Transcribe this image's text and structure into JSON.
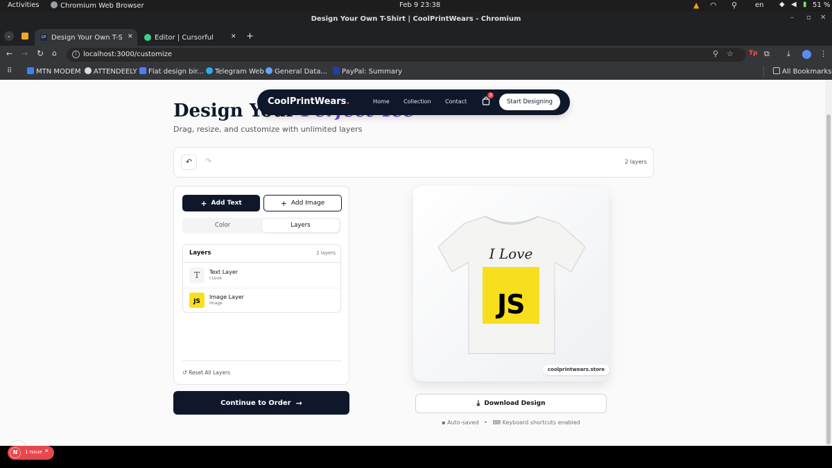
{
  "os": {
    "activities": "Activities",
    "app_name": "Chromium Web Browser",
    "datetime": "Feb 9  23:38",
    "language": "en",
    "battery": "51 %"
  },
  "window": {
    "title": "Design Your Own T-Shirt | CoolPrintWears - Chromium"
  },
  "tabs": [
    {
      "label": "Design Your Own T-Shirt",
      "active": true
    },
    {
      "label": "Editor | Cursorful",
      "active": false
    }
  ],
  "address": {
    "url": "localhost:3000/customize"
  },
  "bookmarks": {
    "items": [
      {
        "label": "MTN MODEM"
      },
      {
        "label": "ATTENDEELY"
      },
      {
        "label": "Flat design bir..."
      },
      {
        "label": "Telegram Web"
      },
      {
        "label": "General Data..."
      },
      {
        "label": "PayPal: Summary"
      }
    ],
    "all_label": "All Bookmarks"
  },
  "nav": {
    "logo": "CoolPrintWears",
    "logo_dot": ".",
    "links": [
      {
        "label": "Home"
      },
      {
        "label": "Collection"
      },
      {
        "label": "Contact"
      }
    ],
    "cart_count": "3",
    "cta": "Start Designing"
  },
  "hero": {
    "title_main": "Design Your",
    "title_accent": "Perfect Tee",
    "subtitle": "Drag, resize, and customize with unlimited layers"
  },
  "toolbar": {
    "layers_count": "2 layers"
  },
  "panel": {
    "add_text": "Add Text",
    "add_image": "Add Image",
    "tabs": [
      {
        "label": "Color",
        "active": false
      },
      {
        "label": "Layers",
        "active": true
      }
    ],
    "layers_title": "Layers",
    "layers_count": "2 layers",
    "layers": [
      {
        "name": "Text Layer",
        "sub": "I Love",
        "icon": "T"
      },
      {
        "name": "Image Layer",
        "sub": "Image",
        "icon": "JS"
      }
    ],
    "reset_label": "Reset All Layers"
  },
  "continue_label": "Continue to Order",
  "preview": {
    "shirt_text": "I Love",
    "logo_text": "JS",
    "watermark": "coolprintwears.store",
    "download_label": "Download Design",
    "autosave_label": "Auto-saved",
    "separator": "•",
    "shortcuts_label": "Keyboard shortcuts enabled"
  },
  "devtools": {
    "badge_letter": "N",
    "issues_label": "1 Issue"
  },
  "colors": {
    "accent": "#7c3aed",
    "dark": "#0f172a",
    "js_yellow": "#f7df1e",
    "issue_red": "#e5484d"
  }
}
